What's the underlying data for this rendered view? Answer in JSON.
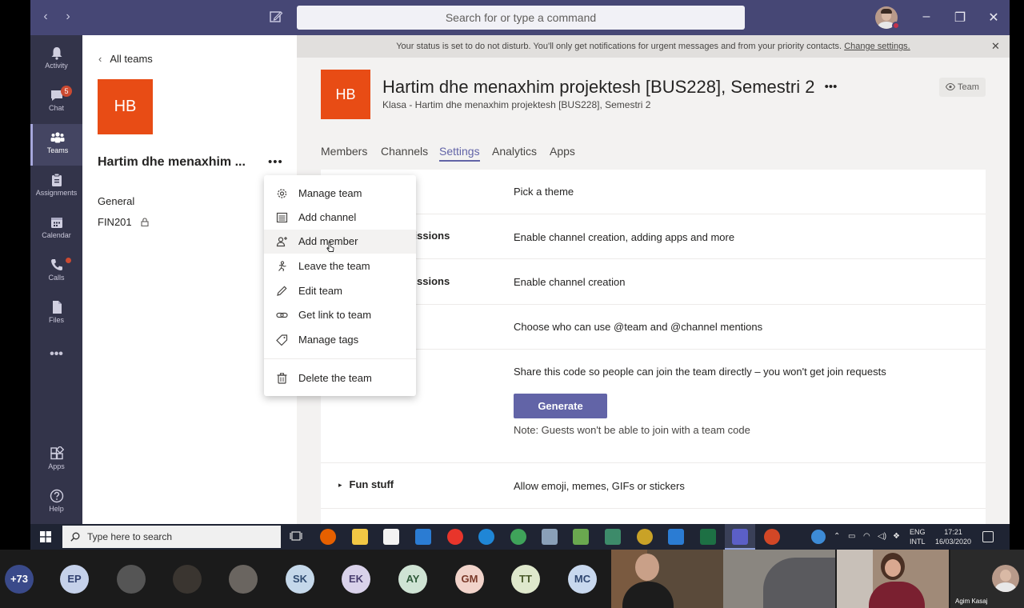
{
  "titlebar": {
    "back_arrow": "‹",
    "forward_arrow": "›",
    "search_placeholder": "Search for or type a command",
    "minimize": "–",
    "restore": "❐",
    "close": "✕"
  },
  "rail": [
    {
      "label": "Activity",
      "icon": "bell-icon"
    },
    {
      "label": "Chat",
      "icon": "chat-icon",
      "badge": "5"
    },
    {
      "label": "Teams",
      "icon": "teams-icon",
      "active": true
    },
    {
      "label": "Assignments",
      "icon": "assignments-icon"
    },
    {
      "label": "Calendar",
      "icon": "calendar-icon"
    },
    {
      "label": "Calls",
      "icon": "phone-icon",
      "dot": true
    },
    {
      "label": "Files",
      "icon": "files-icon"
    },
    {
      "label": "•••",
      "icon": "more-icon"
    },
    {
      "label": "Apps",
      "icon": "apps-icon"
    },
    {
      "label": "Help",
      "icon": "help-icon"
    }
  ],
  "team_pane": {
    "back_label": "All teams",
    "avatar_initials": "HB",
    "team_name": "Hartim dhe menaxhim ...",
    "more": "•••",
    "channels": [
      "General",
      "FIN201"
    ]
  },
  "context_menu": {
    "items": [
      "Manage team",
      "Add channel",
      "Add member",
      "Leave the team",
      "Edit team",
      "Get link to team",
      "Manage tags"
    ],
    "danger_item": "Delete the team",
    "hovered": "Add member"
  },
  "banner": {
    "text": "Your status is set to do not disturb. You'll only get notifications for urgent messages and from your priority contacts.",
    "link": "Change settings.",
    "close": "✕"
  },
  "header": {
    "initials": "HB",
    "title": "Hartim dhe menaxhim projektesh [BUS228], Semestri 2",
    "more": "•••",
    "subtitle": "Klasa - Hartim dhe menaxhim projektesh [BUS228], Semestri 2",
    "team_button": "Team"
  },
  "tabs": [
    "Members",
    "Channels",
    "Settings",
    "Analytics",
    "Apps"
  ],
  "active_tab": "Settings",
  "settings_rows": {
    "theme": {
      "desc": "Pick a theme"
    },
    "member_perms": {
      "title": "missions",
      "desc": "Enable channel creation, adding apps and more"
    },
    "guest_perms": {
      "title": "ssions",
      "desc": "Enable channel creation"
    },
    "mentions": {
      "desc": "Choose who can use @team and @channel mentions"
    },
    "team_code": {
      "desc": "Share this code so people can join the team directly – you won't get join requests",
      "button": "Generate",
      "note": "Note: Guests won't be able to join with a team code"
    },
    "fun_stuff": {
      "title": "Fun stuff",
      "desc": "Allow emoji, memes, GIFs or stickers",
      "chevron": "▸"
    }
  },
  "taskbar": {
    "search_placeholder": "Type here to search",
    "lang_top": "ENG",
    "lang_bottom": "INTL",
    "time": "17:21",
    "date": "16/03/2020",
    "colors": {
      "firefox": "#e66000",
      "explorer": "#f2c744",
      "store": "#f3f3f3",
      "mail": "#2b7cd3",
      "opera": "#e8352b",
      "edge": "#1f86d6",
      "chrome": "#3fa35a",
      "excel": "#1d7044",
      "teams": "#5b5fc7",
      "powerpoint": "#d24726"
    }
  },
  "participants": {
    "overflow": "+73",
    "initials": [
      {
        "text": "EP",
        "bg": "#c5d1ea",
        "fg": "#2f3f6f"
      },
      {
        "text": "SK",
        "bg": "#c5d8ea",
        "fg": "#2f4a6f"
      },
      {
        "text": "EK",
        "bg": "#d9d2ea",
        "fg": "#4a3f6f"
      },
      {
        "text": "AY",
        "bg": "#cfe3d4",
        "fg": "#2f5a3a"
      },
      {
        "text": "GM",
        "bg": "#f1d3ca",
        "fg": "#7a3a2a"
      },
      {
        "text": "TT",
        "bg": "#dfe8cc",
        "fg": "#4a5a2a"
      },
      {
        "text": "MC",
        "bg": "#c8d8ee",
        "fg": "#2f466f"
      }
    ],
    "presenter_name": "Agim Kasaj"
  }
}
